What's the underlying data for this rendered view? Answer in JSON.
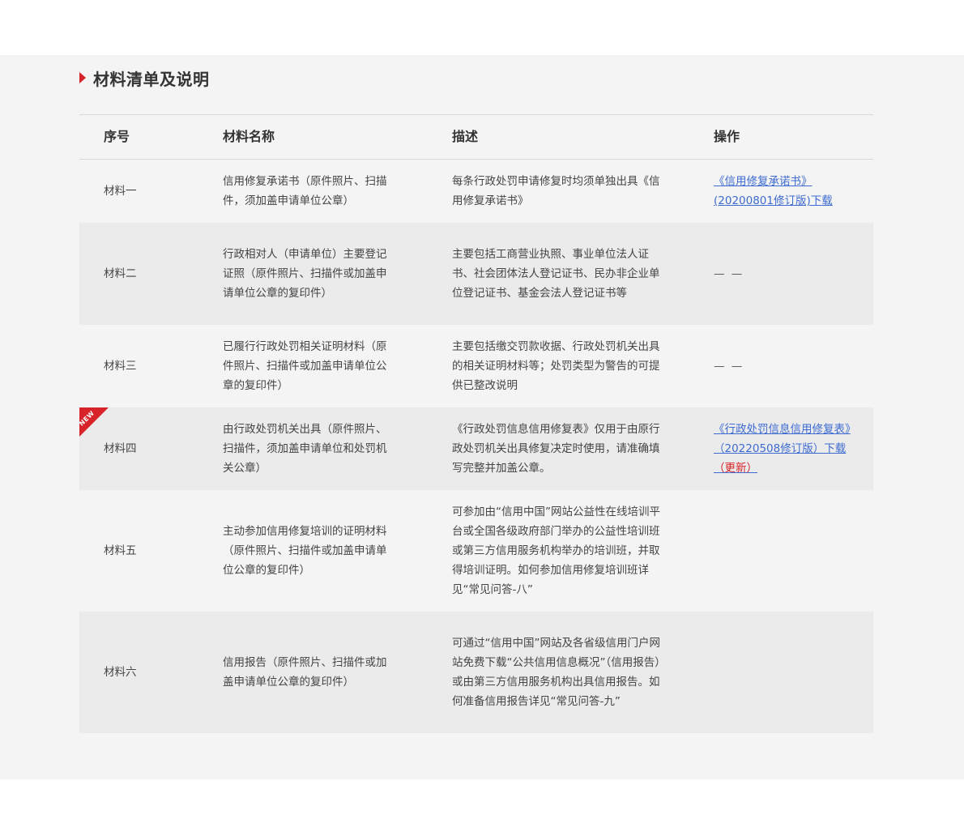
{
  "section": {
    "title": "材料清单及说明"
  },
  "table": {
    "headers": [
      "序号",
      "材料名称",
      "描述",
      "操作"
    ],
    "rows": [
      {
        "no": "材料一",
        "name": "信用修复承诺书（原件照片、扫描件，须加盖申请单位公章）",
        "desc": "每条行政处罚申请修复时均须单独出具《信用修复承诺书》",
        "action_link": "《信用修复承诺书》(20200801修订版)下载",
        "action_extra": "",
        "action_text": ""
      },
      {
        "no": "材料二",
        "name": "行政相对人（申请单位）主要登记证照（原件照片、扫描件或加盖申请单位公章的复印件）",
        "desc": "主要包括工商营业执照、事业单位法人证书、社会团体法人登记证书、民办非企业单位登记证书、基金会法人登记证书等",
        "action_link": "",
        "action_extra": "",
        "action_text": "— —"
      },
      {
        "no": "材料三",
        "name": "已履行行政处罚相关证明材料（原件照片、扫描件或加盖申请单位公章的复印件）",
        "desc": "主要包括缴交罚款收据、行政处罚机关出具的相关证明材料等；处罚类型为警告的可提供已整改说明",
        "action_link": "",
        "action_extra": "",
        "action_text": "— —"
      },
      {
        "no": "材料四",
        "badge": "NEW",
        "name": "由行政处罚机关出具（原件照片、扫描件，须加盖申请单位和处罚机关公章）",
        "desc": "《行政处罚信息信用修复表》仅用于由原行政处罚机关出具修复决定时使用，请准确填写完整并加盖公章。",
        "action_link": "《行政处罚信息信用修复表》（20220508修订版）下载",
        "action_extra": "（更新）",
        "action_text": ""
      },
      {
        "no": "材料五",
        "name": "主动参加信用修复培训的证明材料（原件照片、扫描件或加盖申请单位公章的复印件）",
        "desc": "可参加由“信用中国”网站公益性在线培训平台或全国各级政府部门举办的公益性培训班或第三方信用服务机构举办的培训班，并取得培训证明。如何参加信用修复培训班详见“常见问答-八”",
        "action_link": "",
        "action_extra": "",
        "action_text": ""
      },
      {
        "no": "材料六",
        "name": "信用报告（原件照片、扫描件或加盖申请单位公章的复印件）",
        "desc": "可通过“信用中国”网站及各省级信用门户网站免费下载“公共信用信息概况”（信用报告）或由第三方信用服务机构出具信用报告。如何准备信用报告详见“常见问答-九”",
        "action_link": "",
        "action_extra": "",
        "action_text": ""
      }
    ]
  },
  "colors": {
    "accent": "#d8232a",
    "link": "#3d6bd1",
    "section_bg": "#f4f4f4",
    "shaded_row": "#ebebeb"
  }
}
